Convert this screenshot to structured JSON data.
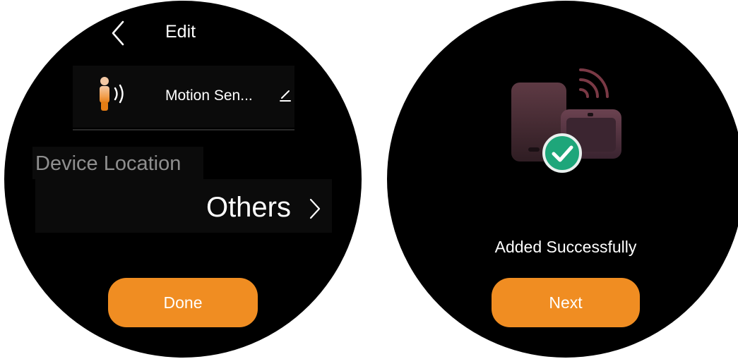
{
  "left_screen": {
    "header": {
      "back_icon": "chevron-left-icon",
      "title": "Edit"
    },
    "device": {
      "icon": "motion-sensor-icon",
      "name": "Motion Sen...",
      "edit_icon": "pencil-icon"
    },
    "location": {
      "label": "Device Location",
      "value": "Others",
      "chevron_icon": "chevron-right-icon"
    },
    "done_button": {
      "label": "Done"
    }
  },
  "right_screen": {
    "illustration_icon": "device-added-icon",
    "status_text": "Added Successfully",
    "next_button": {
      "label": "Next"
    }
  },
  "colors": {
    "accent": "#f08d22",
    "success": "#1ea67a",
    "screen_background": "#000000",
    "secondary_text": "#8f8f8f"
  }
}
